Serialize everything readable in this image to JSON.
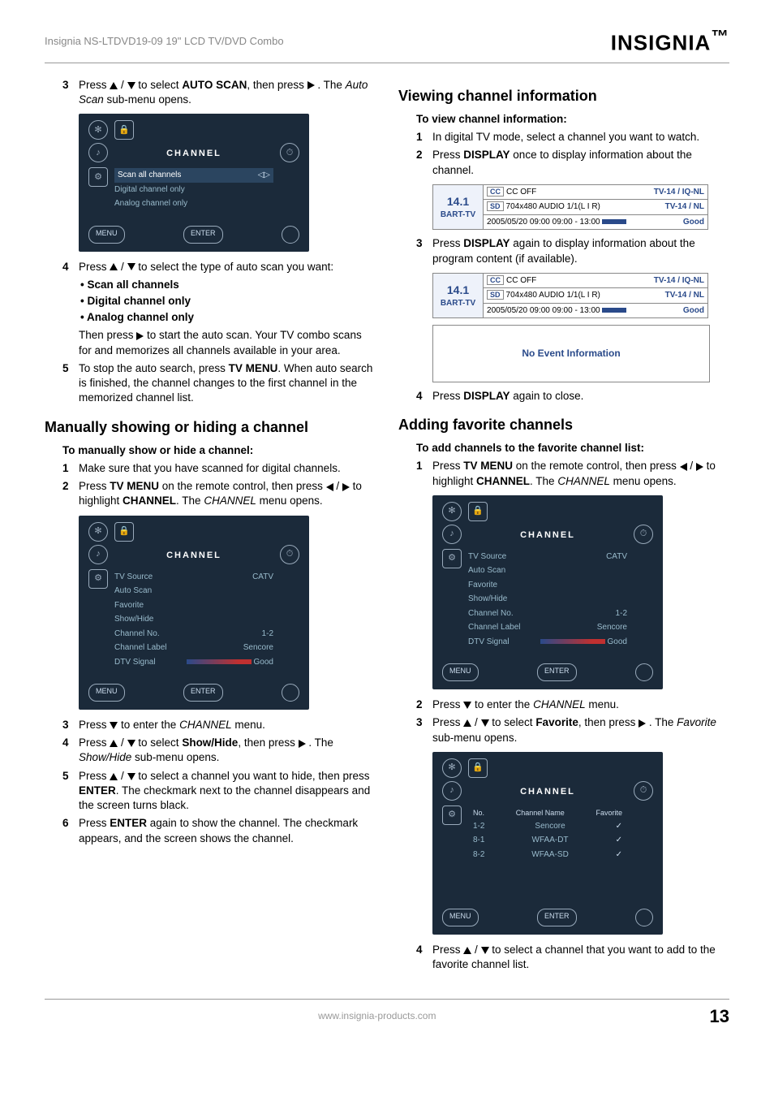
{
  "header": {
    "product": "Insignia NS-LTDVD19-09 19\" LCD TV/DVD Combo",
    "brand": "INSIGNIA"
  },
  "left": {
    "step3": {
      "num": "3",
      "pre": "Press ",
      "mid": " to select ",
      "bold1": "AUTO SCAN",
      "post1": ", then press ",
      "post2": " . The ",
      "ital": "Auto Scan",
      "post3": " sub-menu opens."
    },
    "osd1": {
      "title": "CHANNEL",
      "rows": [
        "Scan all channels",
        "Digital channel only",
        "Analog channel only"
      ],
      "btnMenu": "MENU",
      "btnEnter": "ENTER"
    },
    "step4": {
      "num": "4",
      "pre": "Press ",
      "post": " to select the type of auto scan you want:"
    },
    "bullets": [
      "Scan all channels",
      "Digital channel only",
      "Analog channel only"
    ],
    "step4cont": {
      "pre": "Then press ",
      "post": " to start the auto scan. Your TV combo scans for and memorizes all channels available in your area."
    },
    "step5": {
      "num": "5",
      "pre": "To stop the auto search, press ",
      "bold": "TV MENU",
      "post": ". When auto search is finished, the channel changes to the first channel in the memorized channel list."
    },
    "h2a": "Manually showing or hiding a channel",
    "sub_a": "To manually show or hide a channel:",
    "a1": {
      "num": "1",
      "text": "Make sure that you have scanned for digital channels."
    },
    "a2": {
      "num": "2",
      "pre": "Press ",
      "bold1": "TV MENU",
      "mid": " on the remote control, then press ",
      "mid2": " to highlight ",
      "bold2": "CHANNEL",
      "post": ". The ",
      "ital": "CHANNEL",
      "post2": " menu opens."
    },
    "osd2": {
      "title": "CHANNEL",
      "rows": [
        [
          "TV Source",
          "CATV"
        ],
        [
          "Auto Scan",
          ""
        ],
        [
          "Favorite",
          ""
        ],
        [
          "Show/Hide",
          ""
        ],
        [
          "Channel No.",
          "1-2"
        ],
        [
          "Channel Label",
          "Sencore"
        ],
        [
          "DTV Signal",
          "Good"
        ]
      ],
      "btnMenu": "MENU",
      "btnEnter": "ENTER"
    },
    "a3": {
      "num": "3",
      "pre": "Press ",
      "post": " to enter the ",
      "ital": "CHANNEL",
      "post2": " menu."
    },
    "a4": {
      "num": "4",
      "pre": "Press ",
      "mid": " to select ",
      "bold": "Show/Hide",
      "mid2": ", then press ",
      "post": " . The ",
      "ital": "Show/Hide",
      "post2": " sub-menu opens."
    },
    "a5": {
      "num": "5",
      "pre": "Press ",
      "mid": " to select a channel you want to hide, then press ",
      "bold": "ENTER",
      "post": ". The checkmark next to the channel disappears and the screen turns black."
    },
    "a6": {
      "num": "6",
      "pre": "Press ",
      "bold": "ENTER",
      "post": " again to show the channel. The checkmark appears, and the screen shows the channel."
    }
  },
  "right": {
    "h2b": "Viewing channel information",
    "sub_b": "To view channel information:",
    "b1": {
      "num": "1",
      "text": "In digital TV mode, select a channel you want to watch."
    },
    "b2": {
      "num": "2",
      "pre": "Press ",
      "bold": "DISPLAY",
      "post": " once to display information about the channel."
    },
    "info": {
      "ch": "14.1",
      "name": "BART-TV",
      "r1_tag": "CC",
      "r1_text": "CC  OFF",
      "r1_right": "TV-14 / IQ-NL",
      "r2_tag": "SD",
      "r2_text": "704x480   AUDIO  1/1(L I R)",
      "r2_right": "TV-14 / NL",
      "r3_text": "2005/05/20  09:00     09:00 - 13:00",
      "r3_right": "Good"
    },
    "b3": {
      "num": "3",
      "pre": "Press ",
      "bold": "DISPLAY",
      "post": " again to display information about the program content (if available)."
    },
    "noevent": "No Event Information",
    "b4": {
      "num": "4",
      "pre": "Press ",
      "bold": "DISPLAY",
      "post": " again to close."
    },
    "h2c": "Adding favorite channels",
    "sub_c": "To add channels to the favorite channel list:",
    "c1": {
      "num": "1",
      "pre": "Press ",
      "bold1": "TV MENU",
      "mid": " on the remote control, then press ",
      "mid2": " to highlight ",
      "bold2": "CHANNEL",
      "post": ". The ",
      "ital": "CHANNEL",
      "post2": " menu opens."
    },
    "osd3": {
      "title": "CHANNEL",
      "rows": [
        [
          "TV Source",
          "CATV"
        ],
        [
          "Auto Scan",
          ""
        ],
        [
          "Favorite",
          ""
        ],
        [
          "Show/Hide",
          ""
        ],
        [
          "Channel No.",
          "1-2"
        ],
        [
          "Channel Label",
          "Sencore"
        ],
        [
          "DTV Signal",
          "Good"
        ]
      ],
      "btnMenu": "MENU",
      "btnEnter": "ENTER"
    },
    "c2": {
      "num": "2",
      "pre": "Press ",
      "post": " to enter the ",
      "ital": "CHANNEL",
      "post2": " menu."
    },
    "c3": {
      "num": "3",
      "pre": "Press ",
      "mid": " to select ",
      "bold": "Favorite",
      "mid2": ", then press ",
      "post": " . The ",
      "ital": "Favorite ",
      "post2": "sub-menu opens."
    },
    "osd4": {
      "title": "CHANNEL",
      "head": [
        "No.",
        "Channel Name",
        "Favorite"
      ],
      "rows": [
        [
          "1-2",
          "Sencore",
          "✓"
        ],
        [
          "8-1",
          "WFAA-DT",
          "✓"
        ],
        [
          "8-2",
          "WFAA-SD",
          "✓"
        ]
      ],
      "btnMenu": "MENU",
      "btnEnter": "ENTER"
    },
    "c4": {
      "num": "4",
      "pre": "Press ",
      "post": " to select a channel that you want to add to the favorite channel list."
    }
  },
  "footer": {
    "url": "www.insignia-products.com",
    "page": "13"
  }
}
